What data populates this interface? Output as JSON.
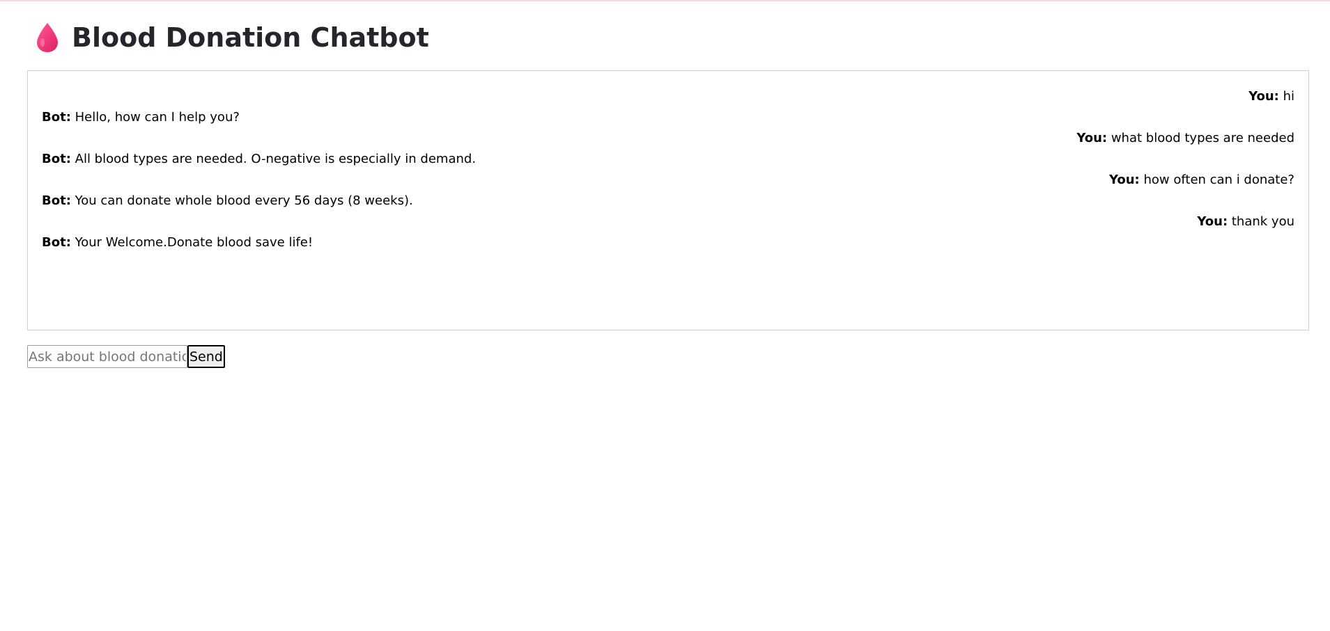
{
  "header": {
    "icon": "blood-drop-icon",
    "title": "Blood Donation Chatbot",
    "accent_color": "#f0327a"
  },
  "chat": {
    "messages": [
      {
        "sender": "user",
        "label": "You:",
        "text": "hi"
      },
      {
        "sender": "bot",
        "label": "Bot:",
        "text": "Hello, how can I help you?"
      },
      {
        "sender": "user",
        "label": "You:",
        "text": "what blood types are needed"
      },
      {
        "sender": "bot",
        "label": "Bot:",
        "text": "All blood types are needed. O-negative is especially in demand."
      },
      {
        "sender": "user",
        "label": "You:",
        "text": "how often can i donate?"
      },
      {
        "sender": "bot",
        "label": "Bot:",
        "text": "You can donate whole blood every 56 days (8 weeks)."
      },
      {
        "sender": "user",
        "label": "You:",
        "text": "thank you"
      },
      {
        "sender": "bot",
        "label": "Bot:",
        "text": "Your Welcome.Donate blood save life!"
      }
    ]
  },
  "composer": {
    "placeholder": "Ask about blood donation...",
    "value": "",
    "send_label": "Send"
  }
}
